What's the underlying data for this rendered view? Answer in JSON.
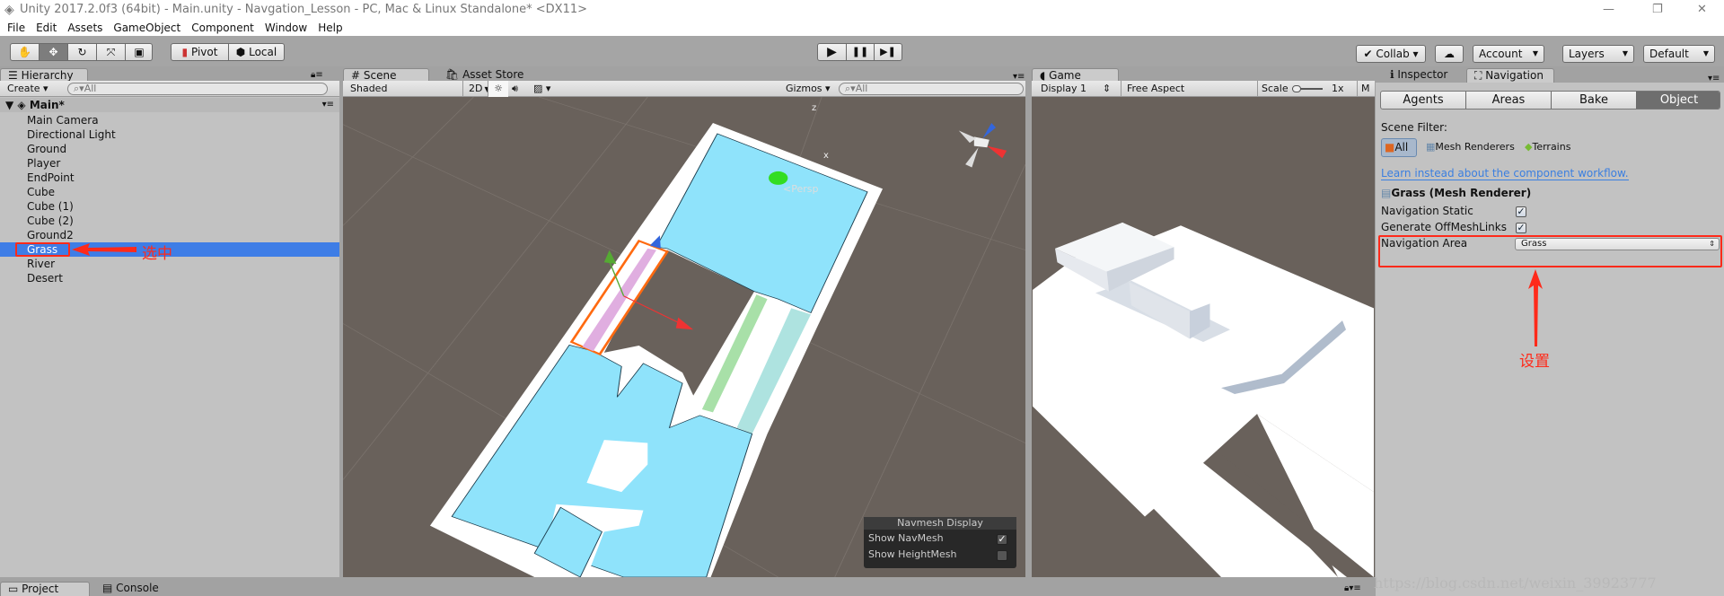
{
  "window": {
    "title": "Unity 2017.2.0f3 (64bit) - Main.unity - Navgation_Lesson - PC, Mac & Linux Standalone* <DX11>",
    "minimize": "—",
    "restore": "❐",
    "close": "✕"
  },
  "menu": [
    "File",
    "Edit",
    "Assets",
    "GameObject",
    "Component",
    "Window",
    "Help"
  ],
  "toolbar": {
    "tools": [
      "hand-tool",
      "move-tool",
      "rotate-tool",
      "scale-tool",
      "rect-tool"
    ],
    "pivot": "Pivot",
    "local": "Local",
    "play": "▶",
    "pause": "❚❚",
    "step": "▶❚",
    "collab": "Collab ▾",
    "account": "Account",
    "layers": "Layers",
    "layout": "Default"
  },
  "hierarchy": {
    "tab": "Hierarchy",
    "create": "Create",
    "search_placeholder": "All",
    "scene": "Main*",
    "items": [
      "Main Camera",
      "Directional Light",
      "Ground",
      "Player",
      "EndPoint",
      "Cube",
      "Cube (1)",
      "Cube (2)",
      "Ground2",
      "Grass",
      "River",
      "Desert"
    ],
    "selected": "Grass",
    "annotation": "选中"
  },
  "scene": {
    "tab": "Scene",
    "tab2": "Asset Store",
    "shading": "Shaded",
    "mode2d": "2D",
    "gizmos": "Gizmos",
    "search_placeholder": "All",
    "persp": "Persp",
    "axis_x": "x",
    "axis_z": "z",
    "navmesh_display": {
      "title": "Navmesh Display",
      "show_navmesh": "Show NavMesh",
      "show_navmesh_checked": true,
      "show_heightmesh": "Show HeightMesh",
      "show_heightmesh_checked": false
    }
  },
  "game": {
    "tab": "Game",
    "display": "Display 1",
    "aspect": "Free Aspect",
    "scale_label": "Scale",
    "scale_value": "1x",
    "maximize": "M"
  },
  "inspector": {
    "tab_inspector": "Inspector",
    "tab_navigation": "Navigation",
    "nav_tabs": [
      "Agents",
      "Areas",
      "Bake",
      "Object"
    ],
    "active_nav_tab": "Object",
    "scene_filter_label": "Scene Filter:",
    "filters": [
      "All",
      "Mesh Renderers",
      "Terrains"
    ],
    "active_filter": "All",
    "link": "Learn instead about the component workflow.",
    "object_header": "Grass (Mesh Renderer)",
    "navigation_static": "Navigation Static",
    "navigation_static_checked": true,
    "generate_offmeshlinks": "Generate OffMeshLinks",
    "generate_offmeshlinks_checked": true,
    "navigation_area": "Navigation Area",
    "navigation_area_value": "Grass",
    "annotation": "设置"
  },
  "bottom": {
    "project_tab": "Project",
    "console_tab": "Console"
  },
  "watermark": "https://blog.csdn.net/weixin_39923777",
  "colors": {
    "selection": "#3e7de6",
    "annotation": "#ff2a1a",
    "navmesh": "#8fe3fb",
    "link": "#3b7fe0"
  }
}
